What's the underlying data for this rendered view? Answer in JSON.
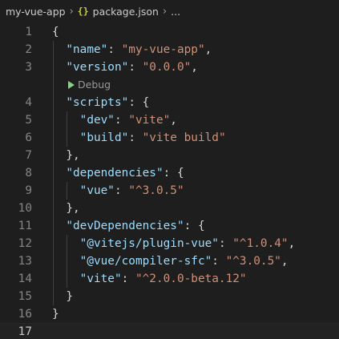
{
  "breadcrumb": {
    "folder": "my-vue-app",
    "json_icon": "{}",
    "file": "package.json",
    "more": "..."
  },
  "codelens": {
    "label": "Debug",
    "icon": "play-icon"
  },
  "current_line": 17,
  "lines": [
    {
      "n": "1",
      "parts": [
        {
          "t": "{",
          "c": "p"
        }
      ]
    },
    {
      "n": "2",
      "parts": [
        {
          "t": "  ",
          "c": "p"
        },
        {
          "t": "\"name\"",
          "c": "k"
        },
        {
          "t": ": ",
          "c": "p"
        },
        {
          "t": "\"my-vue-app\"",
          "c": "s"
        },
        {
          "t": ",",
          "c": "p"
        }
      ]
    },
    {
      "n": "3",
      "parts": [
        {
          "t": "  ",
          "c": "p"
        },
        {
          "t": "\"version\"",
          "c": "k"
        },
        {
          "t": ": ",
          "c": "p"
        },
        {
          "t": "\"0.0.0\"",
          "c": "s"
        },
        {
          "t": ",",
          "c": "p"
        }
      ]
    },
    {
      "n": "4",
      "parts": [
        {
          "t": "  ",
          "c": "p"
        },
        {
          "t": "\"scripts\"",
          "c": "k"
        },
        {
          "t": ": {",
          "c": "p"
        }
      ]
    },
    {
      "n": "5",
      "parts": [
        {
          "t": "    ",
          "c": "p"
        },
        {
          "t": "\"dev\"",
          "c": "k"
        },
        {
          "t": ": ",
          "c": "p"
        },
        {
          "t": "\"vite\"",
          "c": "s"
        },
        {
          "t": ",",
          "c": "p"
        }
      ]
    },
    {
      "n": "6",
      "parts": [
        {
          "t": "    ",
          "c": "p"
        },
        {
          "t": "\"build\"",
          "c": "k"
        },
        {
          "t": ": ",
          "c": "p"
        },
        {
          "t": "\"vite build\"",
          "c": "s"
        }
      ]
    },
    {
      "n": "7",
      "parts": [
        {
          "t": "  },",
          "c": "p"
        }
      ]
    },
    {
      "n": "8",
      "parts": [
        {
          "t": "  ",
          "c": "p"
        },
        {
          "t": "\"dependencies\"",
          "c": "k"
        },
        {
          "t": ": {",
          "c": "p"
        }
      ]
    },
    {
      "n": "9",
      "parts": [
        {
          "t": "    ",
          "c": "p"
        },
        {
          "t": "\"vue\"",
          "c": "k"
        },
        {
          "t": ": ",
          "c": "p"
        },
        {
          "t": "\"^3.0.5\"",
          "c": "s"
        }
      ]
    },
    {
      "n": "10",
      "parts": [
        {
          "t": "  },",
          "c": "p"
        }
      ]
    },
    {
      "n": "11",
      "parts": [
        {
          "t": "  ",
          "c": "p"
        },
        {
          "t": "\"devDependencies\"",
          "c": "k"
        },
        {
          "t": ": {",
          "c": "p"
        }
      ]
    },
    {
      "n": "12",
      "parts": [
        {
          "t": "    ",
          "c": "p"
        },
        {
          "t": "\"@vitejs/plugin-vue\"",
          "c": "k"
        },
        {
          "t": ": ",
          "c": "p"
        },
        {
          "t": "\"^1.0.4\"",
          "c": "s"
        },
        {
          "t": ",",
          "c": "p"
        }
      ]
    },
    {
      "n": "13",
      "parts": [
        {
          "t": "    ",
          "c": "p"
        },
        {
          "t": "\"@vue/compiler-sfc\"",
          "c": "k"
        },
        {
          "t": ": ",
          "c": "p"
        },
        {
          "t": "\"^3.0.5\"",
          "c": "s"
        },
        {
          "t": ",",
          "c": "p"
        }
      ]
    },
    {
      "n": "14",
      "parts": [
        {
          "t": "    ",
          "c": "p"
        },
        {
          "t": "\"vite\"",
          "c": "k"
        },
        {
          "t": ": ",
          "c": "p"
        },
        {
          "t": "\"^2.0.0-beta.12\"",
          "c": "s"
        }
      ]
    },
    {
      "n": "15",
      "parts": [
        {
          "t": "  }",
          "c": "p"
        }
      ]
    },
    {
      "n": "16",
      "parts": [
        {
          "t": "}",
          "c": "p"
        }
      ]
    },
    {
      "n": "17",
      "parts": []
    }
  ],
  "colors": {
    "background": "#1e1e1e",
    "property_key": "#9cdcfe",
    "string_value": "#ce9178",
    "punctuation": "#d4d4d4",
    "line_number": "#858585",
    "json_icon": "#cbcb41",
    "debug_play": "#89d185"
  }
}
